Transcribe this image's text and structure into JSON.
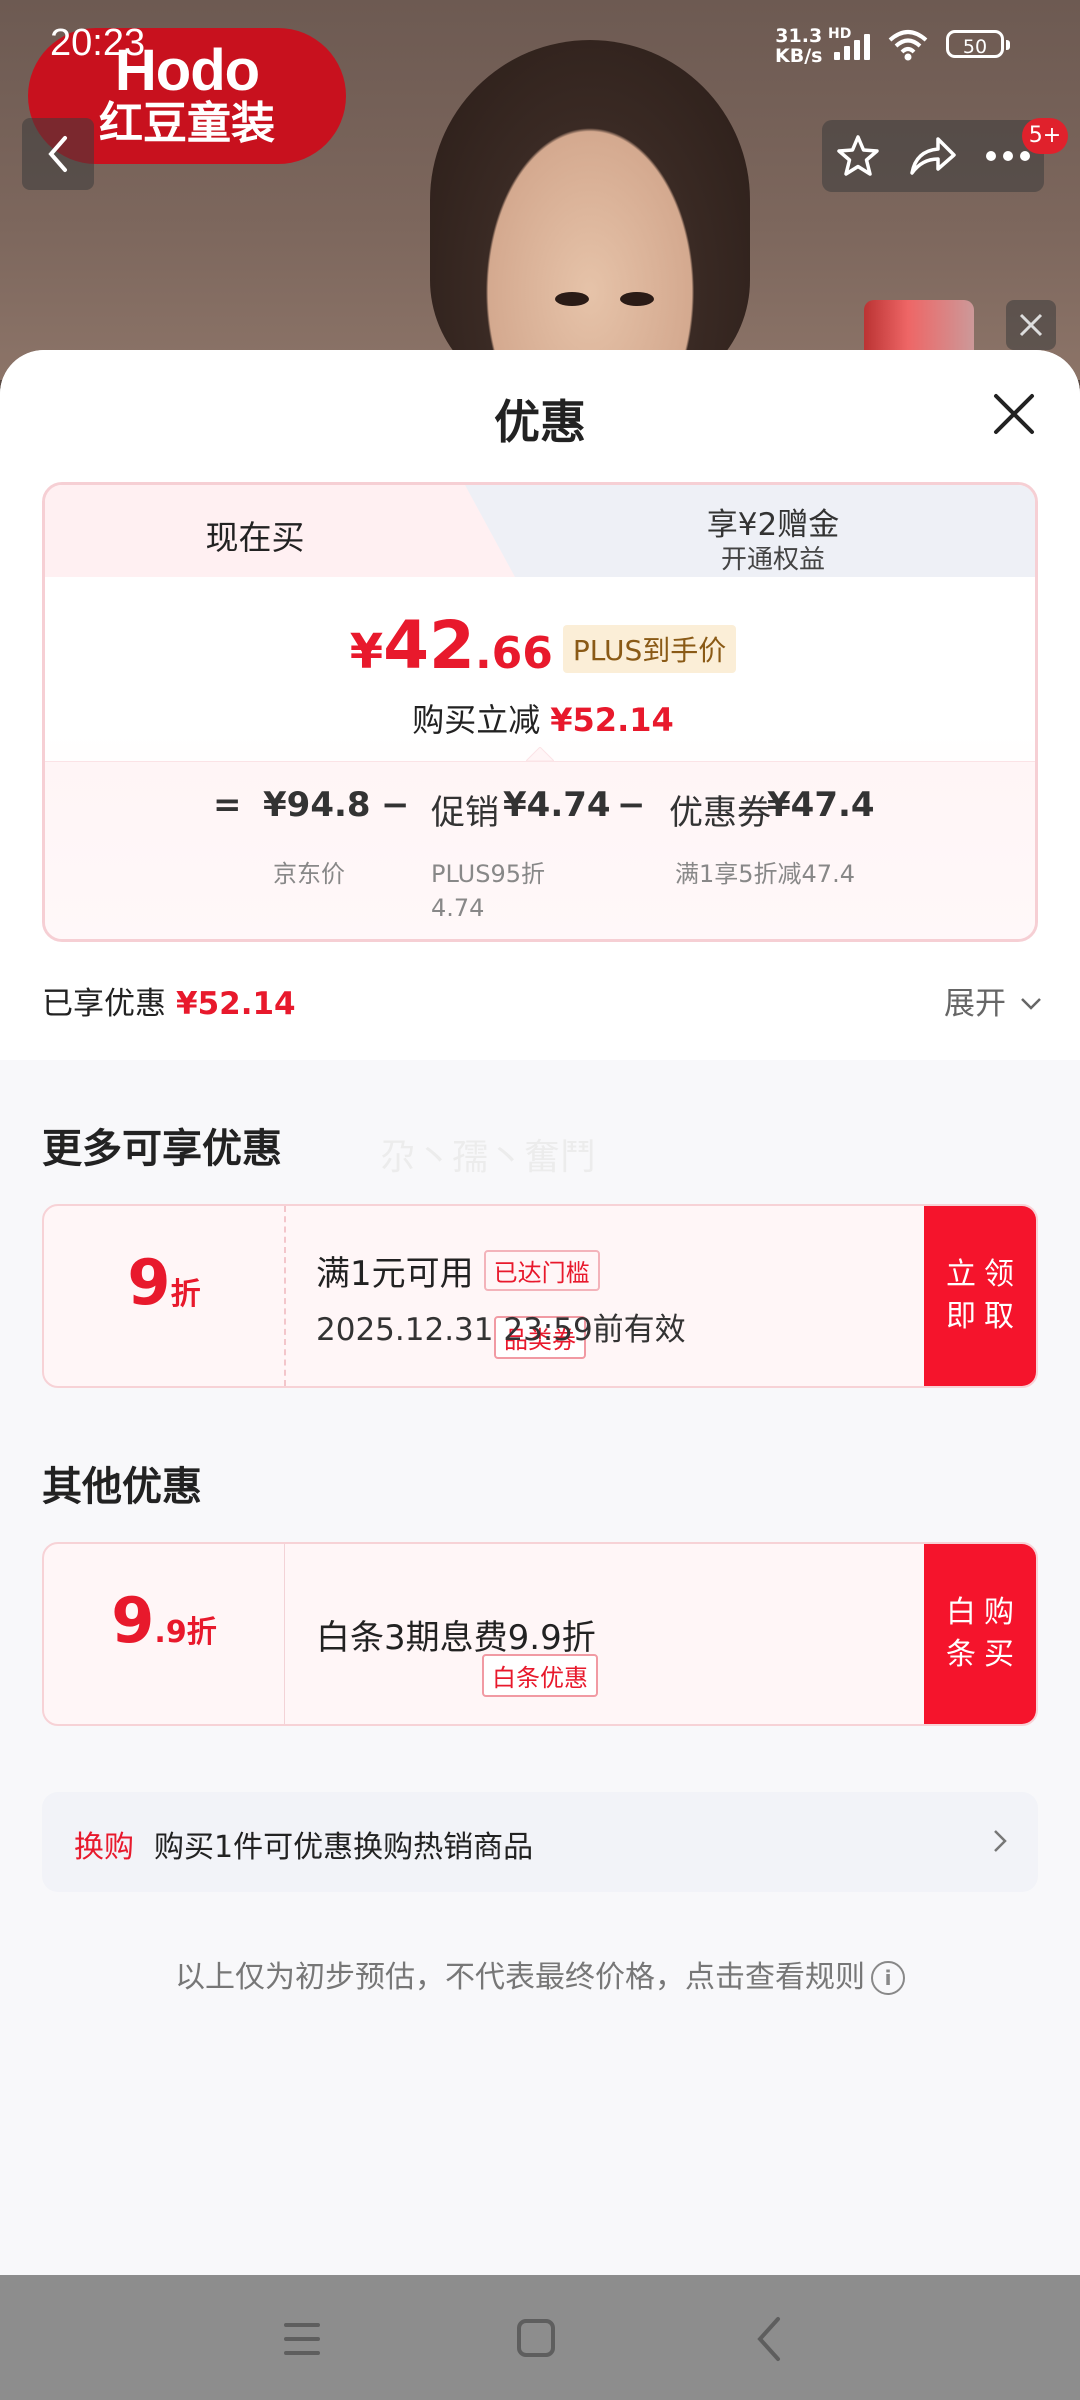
{
  "status_bar": {
    "time": "20:23",
    "net_speed_value": "31.3",
    "net_speed_unit": "KB/s",
    "hd_label": "HD",
    "battery": "50"
  },
  "background": {
    "brand_logo_en": "Hodo",
    "brand_logo_zh": "红豆童装",
    "notification_badge": "5+"
  },
  "sheet": {
    "title": "优惠",
    "tabs": [
      {
        "label": "现在买",
        "selected": true
      },
      {
        "label": "享¥2赠金",
        "sublabel": "开通权益",
        "selected": false
      }
    ],
    "final_price": {
      "currency": "¥",
      "integer": "42",
      "decimal": ".66",
      "tag": "PLUS到手价"
    },
    "reduce": {
      "label": "购买立减",
      "value": "¥52.14"
    },
    "breakdown": {
      "equals": "=",
      "items": [
        {
          "op": "",
          "label": "",
          "value": "¥94.8",
          "sub": "京东价"
        },
        {
          "op": "−",
          "label": "促销",
          "value": "¥4.74",
          "sub": "PLUS95折 4.74"
        },
        {
          "op": "−",
          "label": "优惠券",
          "value": "¥47.4",
          "sub": "满1享5折减47.4"
        }
      ]
    },
    "enjoyed": {
      "label": "已享优惠",
      "value": "¥52.14"
    },
    "expand_label": "展开"
  },
  "more_offers": {
    "title": "更多可享优惠",
    "watermark": "尕丶孺丶奮鬥",
    "coupon": {
      "discount_num": "9",
      "discount_unit": "折",
      "tag": "品类券",
      "condition": "满1元可用",
      "status_tag": "已达门槛",
      "validity": "2025.12.31 23:59前有效",
      "action": "立即领取"
    }
  },
  "other_offers": {
    "title": "其他优惠",
    "offer": {
      "discount_num": "9",
      "discount_dec": ".9",
      "discount_unit": "折",
      "tag": "白条优惠",
      "description": "白条3期息费9.9折",
      "action": "白条购买"
    }
  },
  "swap": {
    "label": "换购",
    "text": "购买1件可优惠换购热销商品"
  },
  "disclaimer": "以上仅为初步预估，不代表最终价格，点击查看规则",
  "colors": {
    "accent_red": "#e8192c",
    "button_red": "#f5142c",
    "plus_gold": "#8a5a16"
  }
}
